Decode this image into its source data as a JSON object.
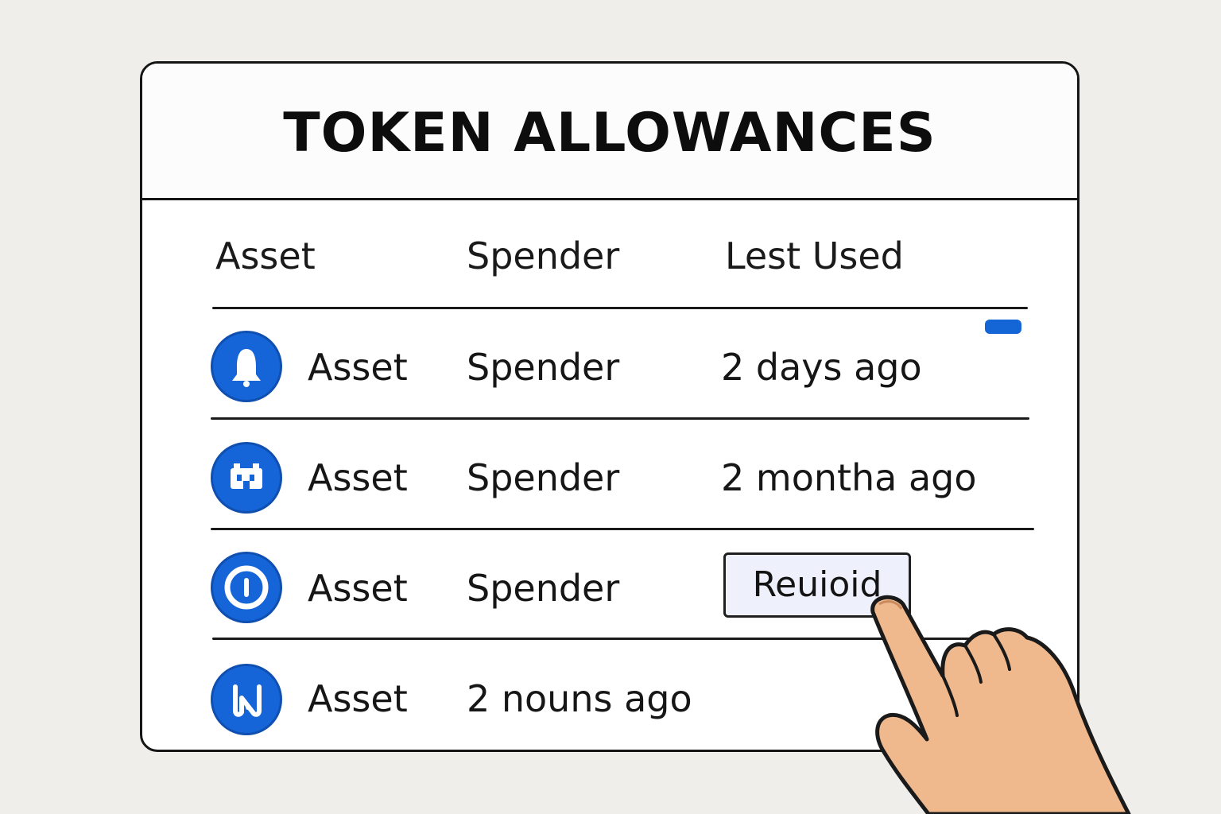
{
  "title": "TOKEN ALLOWANCES",
  "columns": {
    "asset": "Asset",
    "spender": "Spender",
    "last_used": "Lest Used"
  },
  "rows": [
    {
      "asset": "Asset",
      "spender": "Spender",
      "last_used": "2 days ago",
      "icon": "bell-icon"
    },
    {
      "asset": "Asset",
      "spender": "Spender",
      "last_used": "2 montha ago",
      "icon": "building-icon"
    },
    {
      "asset": "Asset",
      "spender": "Spender",
      "action": "Reuioid",
      "icon": "ring-icon"
    },
    {
      "asset": "Asset",
      "spender": "2 nouns ago",
      "icon": "n-logo-icon"
    }
  ],
  "colors": {
    "accent": "#1565d8",
    "hand": "#f0b98d",
    "background": "#efeeea"
  }
}
